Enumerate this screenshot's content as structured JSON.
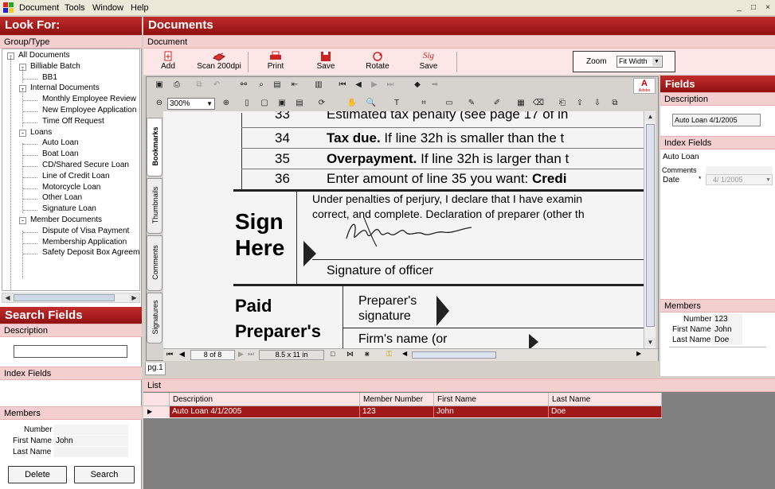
{
  "menu": {
    "items": [
      "Document",
      "Tools",
      "Window",
      "Help"
    ]
  },
  "window_controls": {
    "minimize": "_",
    "restore": "□",
    "close": "×"
  },
  "left": {
    "look_for": "Look For:",
    "group_type": "Group/Type",
    "tree": [
      {
        "label": "All Documents",
        "level": 0,
        "expander": "-"
      },
      {
        "label": "Billiable Batch",
        "level": 1,
        "expander": "-"
      },
      {
        "label": "BB1",
        "level": 2,
        "expander": ""
      },
      {
        "label": "Internal Documents",
        "level": 1,
        "expander": "-"
      },
      {
        "label": "Monthly Employee Review",
        "level": 2,
        "expander": ""
      },
      {
        "label": "New Employee Application",
        "level": 2,
        "expander": ""
      },
      {
        "label": "Time Off Request",
        "level": 2,
        "expander": ""
      },
      {
        "label": "Loans",
        "level": 1,
        "expander": "-"
      },
      {
        "label": "Auto Loan",
        "level": 2,
        "expander": ""
      },
      {
        "label": "Boat Loan",
        "level": 2,
        "expander": ""
      },
      {
        "label": "CD/Shared Secure Loan",
        "level": 2,
        "expander": ""
      },
      {
        "label": "Line of Credit Loan",
        "level": 2,
        "expander": ""
      },
      {
        "label": "Motorcycle Loan",
        "level": 2,
        "expander": ""
      },
      {
        "label": "Other Loan",
        "level": 2,
        "expander": ""
      },
      {
        "label": "Signature Loan",
        "level": 2,
        "expander": ""
      },
      {
        "label": "Member Documents",
        "level": 1,
        "expander": "-"
      },
      {
        "label": "Dispute of Visa Payment",
        "level": 2,
        "expander": ""
      },
      {
        "label": "Membership Application",
        "level": 2,
        "expander": ""
      },
      {
        "label": "Safety Deposit Box Agreement",
        "level": 2,
        "expander": ""
      }
    ],
    "search_fields": "Search Fields",
    "description": "Description",
    "description_value": "",
    "index_fields": "Index Fields",
    "members": "Members",
    "number_label": "Number",
    "number_value": "",
    "first_name_label": "First Name",
    "first_name_value": "John",
    "last_name_label": "Last Name",
    "last_name_value": "",
    "delete_button": "Delete",
    "search_button": "Search"
  },
  "main": {
    "title": "Documents",
    "section": "Document",
    "toolbar": {
      "add": "Add",
      "scan": "Scan 200dpi",
      "print": "Print",
      "save": "Save",
      "rotate": "Rotate",
      "sig_icon_text": "Sig",
      "sig_save": "Save",
      "zoom_label": "Zoom",
      "zoom_value": "Fit Width"
    },
    "viewer": {
      "zoom_percent": "300%",
      "tabs": [
        "Bookmarks",
        "Thumbnails",
        "Comments",
        "Signatures"
      ],
      "page_indicator": "8 of 8",
      "page_size": "8.5 x 11 in",
      "page_tab": "pg.1",
      "adobe": "Adobe"
    },
    "document": {
      "line33_num": "33",
      "line33_text": "Estimated tax penalty (see page 17 of in",
      "line34_num": "34",
      "line34_bold": "Tax due.",
      "line34_text": " If line 32h is smaller than the t",
      "line35_num": "35",
      "line35_bold": "Overpayment.",
      "line35_text": " If line 32h is larger than t",
      "line36_num": "36",
      "line36_text": "Enter amount of line 35 you want: ",
      "line36_bold": "Credi",
      "sign_here_1": "Sign",
      "sign_here_2": "Here",
      "penalty_1": "Under penalties of perjury, I declare that I have examin",
      "penalty_2": "correct, and complete. Declaration of preparer (other th",
      "signature_of_officer": "Signature of officer",
      "paid_1": "Paid",
      "paid_2": "Preparer's",
      "preparer_sig_1": "Preparer's",
      "preparer_sig_2": "signature",
      "firms_name": "Firm's name (or"
    },
    "list": {
      "title": "List",
      "columns": [
        "Description",
        "Member Number",
        "First Name",
        "Last Name"
      ],
      "rows": [
        [
          "Auto Loan 4/1/2005",
          "123",
          "John",
          "Doe"
        ]
      ],
      "row_marker": "▶"
    }
  },
  "right": {
    "title": "Fields",
    "description": "Description",
    "description_value": "Auto Loan 4/1/2005",
    "index_fields": "Index Fields",
    "doc_type": "Auto Loan",
    "comments_label": "Comments",
    "date_label": "Date",
    "date_required": "*",
    "date_value": "4/ 1/2005",
    "members": "Members",
    "number_label": "Number",
    "number_value": "123",
    "first_name_label": "First Name",
    "first_name_value": "John",
    "last_name_label": "Last Name",
    "last_name_value": "Doe"
  },
  "colors": {
    "accent": "#a01818",
    "header_light": "#f3cfcf"
  }
}
